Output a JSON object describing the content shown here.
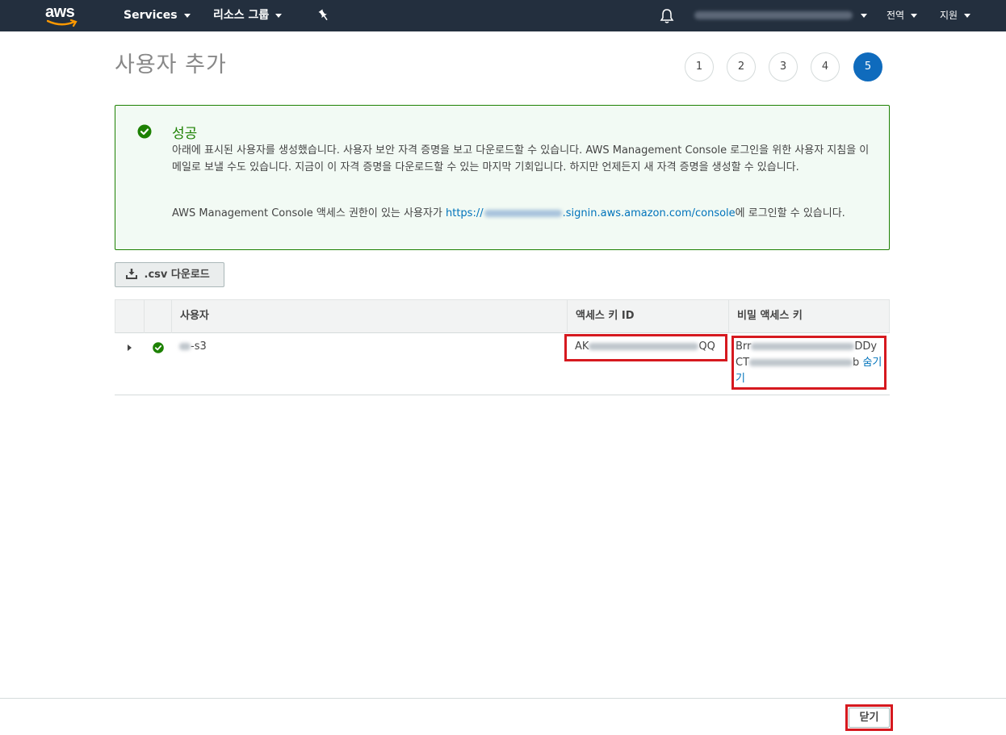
{
  "nav": {
    "logo_text": "aws",
    "services_label": "Services",
    "resource_groups_label": "리소스 그룹",
    "region_label": "전역",
    "support_label": "지원",
    "colors": {
      "nav_bg": "#232f3e",
      "smile": "#ff9900"
    }
  },
  "page": {
    "title": "사용자 추가",
    "steps": [
      "1",
      "2",
      "3",
      "4",
      "5"
    ],
    "active_step": "5"
  },
  "alert": {
    "title": "성공",
    "message": "아래에 표시된 사용자를 생성했습니다. 사용자 보안 자격 증명을 보고 다운로드할 수 있습니다. AWS Management Console 로그인을 위한 사용자 지침을 이메일로 보낼 수도 있습니다. 지금이 이 자격 증명을 다운로드할 수 있는 마지막 기회입니다. 하지만 언제든지 새 자격 증명을 생성할 수 있습니다.",
    "console_prefix": "AWS Management Console 액세스 권한이 있는 사용자가",
    "console_link_start": "https://",
    "console_link_end": ".signin.aws.amazon.com/console",
    "console_suffix": "에 로그인할 수 있습니다.",
    "colors": {
      "border": "#1d8102",
      "bg": "#f2faf4"
    }
  },
  "csv_button": {
    "label": ".csv 다운로드"
  },
  "table": {
    "headers": {
      "user": "사용자",
      "access_key_id": "액세스 키 ID",
      "secret_key": "비밀 액세스 키"
    },
    "row": {
      "user_suffix": "-s3",
      "access_key_start": "AK",
      "access_key_end": "QQ",
      "secret_line1_start": "Brr",
      "secret_line1_end": "DDy",
      "secret_line2_start": "CT",
      "secret_line2_end": "b",
      "hide_link": "숨기기"
    }
  },
  "footer": {
    "close_label": "닫기"
  },
  "highlight_color": "#d6191f"
}
